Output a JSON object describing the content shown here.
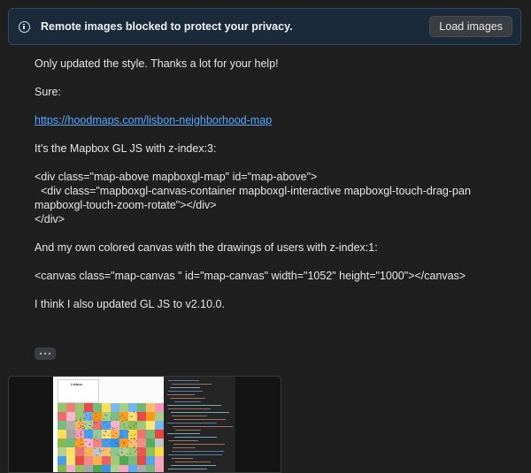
{
  "banner": {
    "icon": "info-icon",
    "message": "Remote images blocked to protect your privacy.",
    "load_button": "Load images"
  },
  "message": {
    "line1": "Only updated the style. Thanks a lot for your help!",
    "line2": "Sure:",
    "link": "https://hoodmaps.com/lisbon-neighborhood-map",
    "line3": "It's the Mapbox GL JS with z-index:3:",
    "code1_l1": "<div class=\"map-above mapboxgl-map\" id=\"map-above\">",
    "code1_l2": "  <div class=\"mapboxgl-canvas-container mapboxgl-interactive mapboxgl-touch-drag-pan mapboxgl-touch-zoom-rotate\"></div>",
    "code1_l3": "</div>",
    "line4": "And my own colored canvas with the drawings of users with z-index:1:",
    "code2": "<canvas class=\"map-canvas \" id=\"map-canvas\" width=\"1052\" height=\"1000\"></canvas>",
    "line5": "I think I also updated GL JS to v2.10.0."
  },
  "more_button": {
    "icon": "ellipsis-icon"
  },
  "attachment": {
    "type": "screenshot-thumbnail",
    "caption": "Lisbon",
    "colors": [
      "#e53935",
      "#fb8c00",
      "#fdd835",
      "#7cb342",
      "#43a047",
      "#1e88e5",
      "#9e9e9e",
      "#f48fb1"
    ]
  }
}
